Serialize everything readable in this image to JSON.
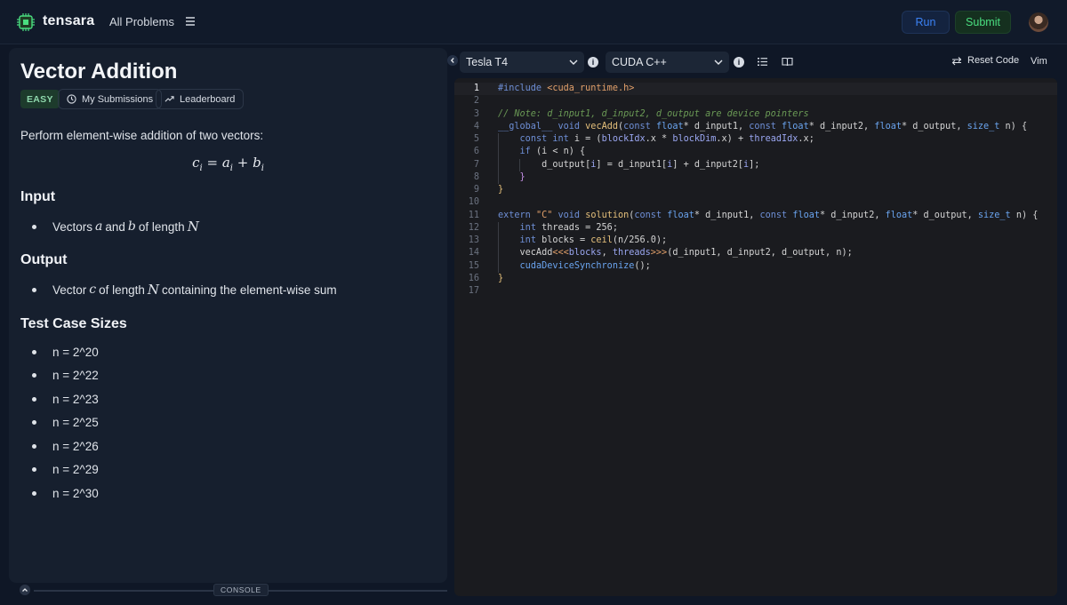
{
  "nav": {
    "brand": "tensara",
    "all_problems": "All Problems",
    "run_label": "Run",
    "submit_label": "Submit"
  },
  "problem": {
    "title": "Vector Addition",
    "difficulty": "EASY",
    "my_submissions": "My Submissions",
    "leaderboard": "Leaderboard",
    "description": "Perform element-wise addition of two vectors:",
    "formula": {
      "lhs": "c",
      "lhs_sub": "i",
      "a": "a",
      "a_sub": "i",
      "b": "b",
      "b_sub": "i"
    },
    "input_heading": "Input",
    "input_item": {
      "prefix": "Vectors",
      "var_a": "a",
      "and": "and",
      "var_b": "b",
      "suffix": "of length",
      "var_n": "N"
    },
    "output_heading": "Output",
    "output_item": {
      "prefix": "Vector",
      "var_c": "c",
      "mid": "of length",
      "var_n": "N",
      "suffix": "containing the element-wise sum"
    },
    "test_heading": "Test Case Sizes",
    "test_sizes": [
      "n = 2^20",
      "n = 2^22",
      "n = 2^23",
      "n = 2^25",
      "n = 2^26",
      "n = 2^29",
      "n = 2^30"
    ]
  },
  "console": {
    "label": "CONSOLE"
  },
  "editor": {
    "gpu": "Tesla T4",
    "language": "CUDA C++",
    "reset_label": "Reset Code",
    "vim_label": "Vim",
    "line_numbers": [
      "1",
      "2",
      "3",
      "4",
      "5",
      "6",
      "7",
      "8",
      "9",
      "10",
      "11",
      "12",
      "13",
      "14",
      "15",
      "16",
      "17"
    ]
  },
  "colors": {
    "run": "#3b82f6",
    "submit": "#4ade80",
    "easy": "#8fd8ad"
  }
}
